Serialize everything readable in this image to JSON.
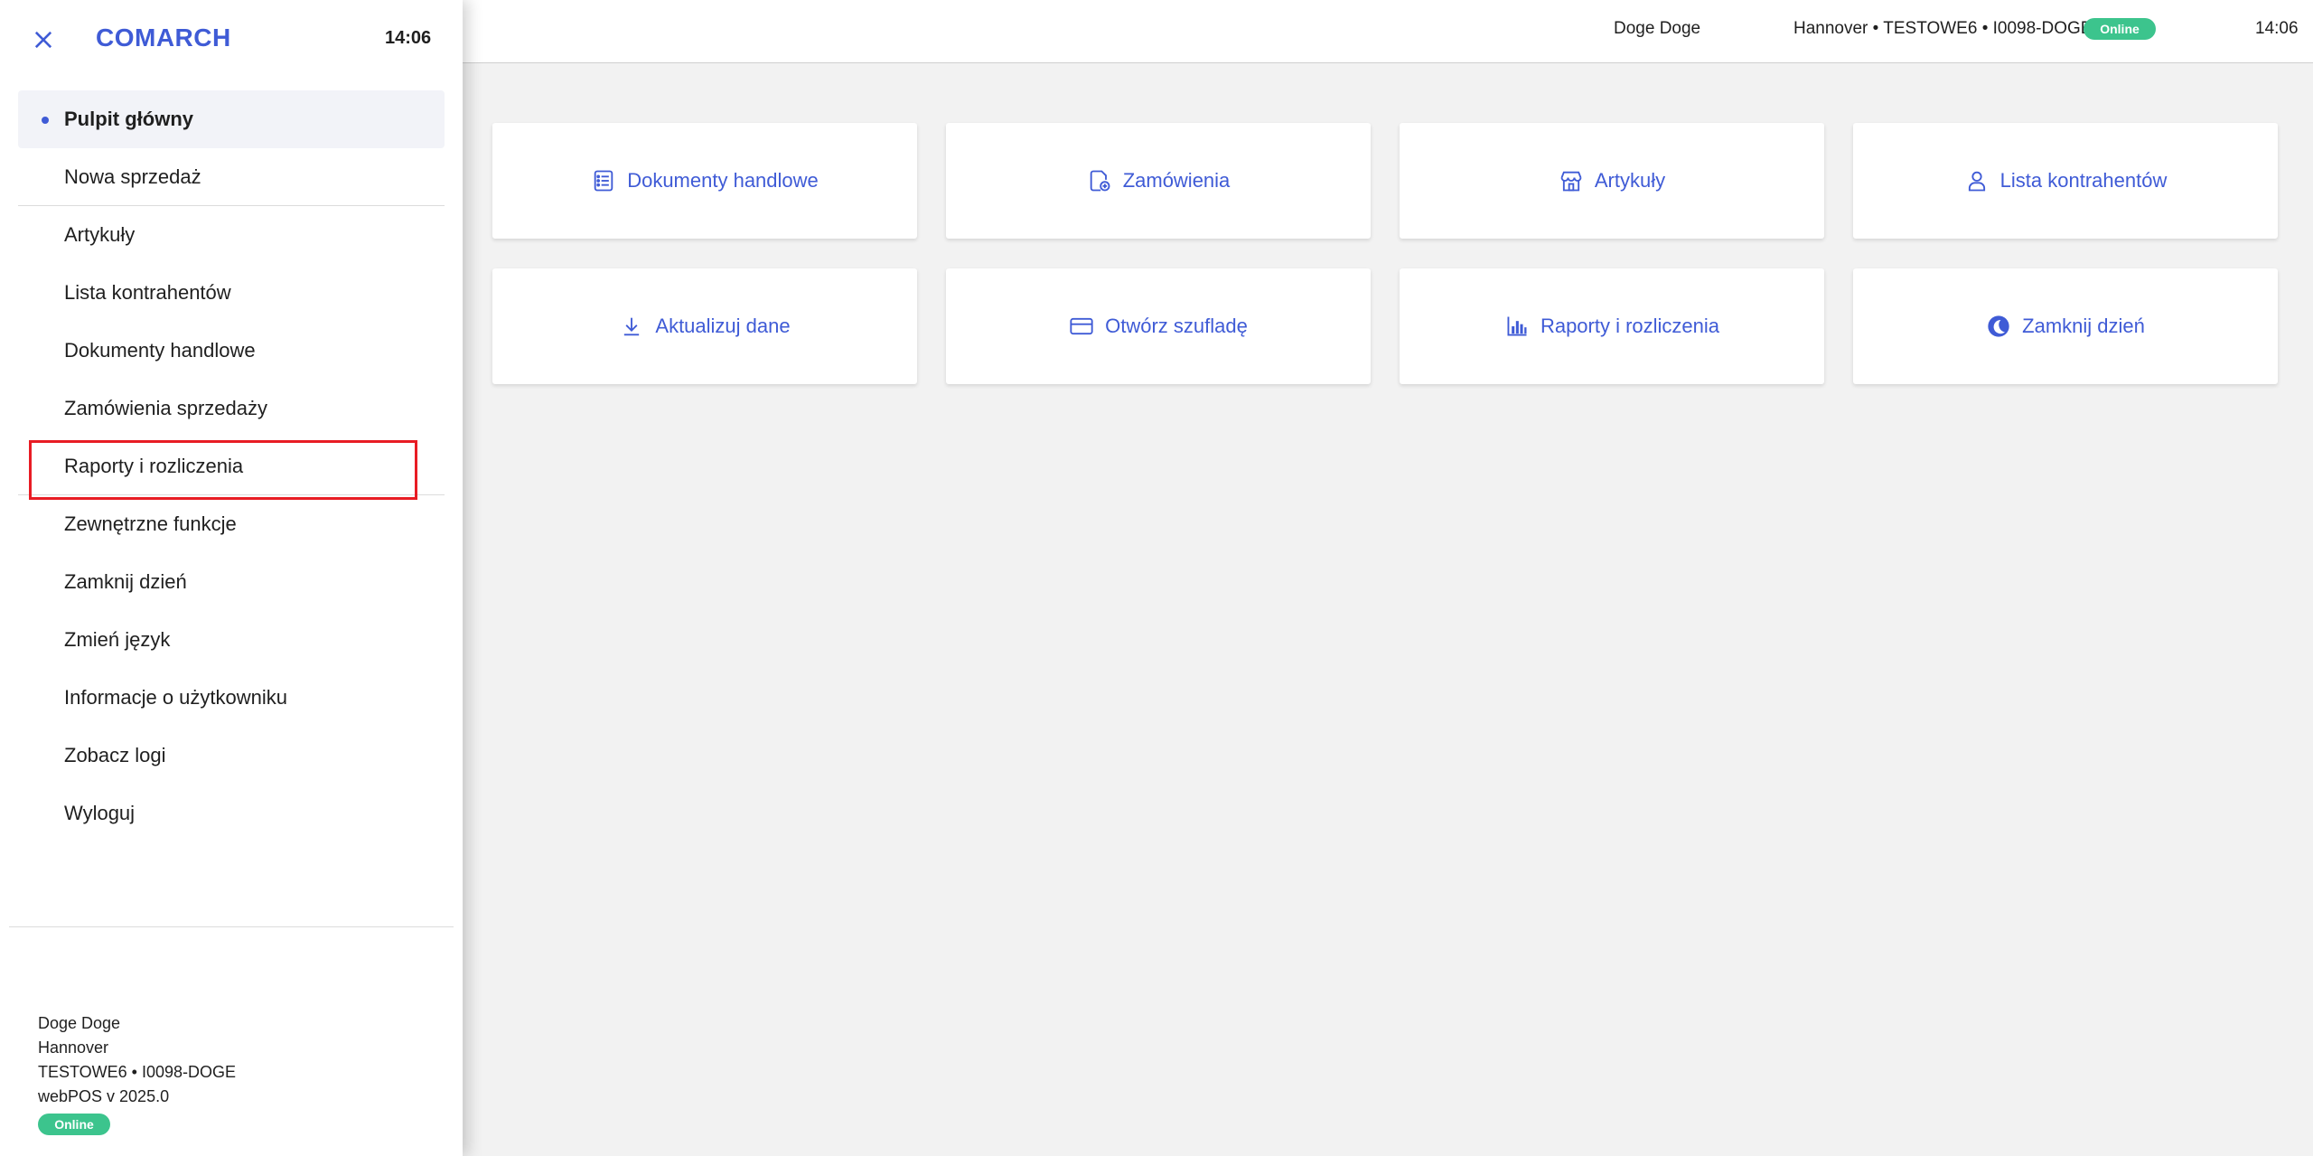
{
  "topbar": {
    "user": "Doge Doge",
    "location": "Hannover • TESTOWE6 • I0098-DOGE",
    "status": "Online",
    "time": "14:06"
  },
  "tiles": [
    {
      "label": "Dokumenty handlowe",
      "icon": "list-icon"
    },
    {
      "label": "Zamówienia",
      "icon": "order-icon"
    },
    {
      "label": "Artykuły",
      "icon": "store-icon"
    },
    {
      "label": "Lista kontrahentów",
      "icon": "person-icon"
    },
    {
      "label": "Aktualizuj dane",
      "icon": "download-icon"
    },
    {
      "label": "Otwórz szufladę",
      "icon": "card-icon"
    },
    {
      "label": "Raporty i rozliczenia",
      "icon": "bar-chart-icon"
    },
    {
      "label": "Zamknij dzień",
      "icon": "moon-icon"
    }
  ],
  "sidebar": {
    "logo": "COMARCH",
    "time": "14:06",
    "items": [
      {
        "label": "Pulpit główny"
      },
      {
        "label": "Nowa sprzedaż"
      },
      {
        "label": "Artykuły"
      },
      {
        "label": "Lista kontrahentów"
      },
      {
        "label": "Dokumenty handlowe"
      },
      {
        "label": "Zamówienia sprzedaży"
      },
      {
        "label": "Raporty i rozliczenia"
      },
      {
        "label": "Zewnętrzne funkcje"
      },
      {
        "label": "Zamknij dzień"
      },
      {
        "label": "Zmień język"
      },
      {
        "label": "Informacje o użytkowniku"
      },
      {
        "label": "Zobacz logi"
      },
      {
        "label": "Wyloguj"
      }
    ],
    "footer": {
      "user": "Doge Doge",
      "store": "Hannover",
      "terminal": "TESTOWE6 • I0098-DOGE",
      "version": "webPOS v 2025.0",
      "status": "Online"
    }
  },
  "colors": {
    "accent": "#3f5bd6",
    "online": "#3cc48d",
    "highlight": "#e81c24",
    "background": "#f2f2f2"
  }
}
